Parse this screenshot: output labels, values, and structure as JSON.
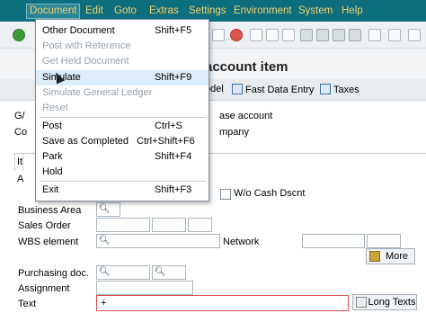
{
  "menubar": {
    "items": [
      "Document",
      "Edit",
      "Goto",
      "Extras",
      "Settings",
      "Environment",
      "System",
      "Help"
    ]
  },
  "title": "account item",
  "app_toolbar": {
    "model": "odel",
    "fast_data_entry": "Fast Data Entry",
    "taxes": "Taxes"
  },
  "header": {
    "label_g": "G/",
    "label_co": "Co",
    "label_i": "It",
    "label_a": "A",
    "gl_text": "ase account",
    "company_text": "mpany",
    "wo_cash": "W/o Cash Dscnt"
  },
  "form": {
    "business_area": "Business Area",
    "sales_order": "Sales Order",
    "wbs_element": "WBS element",
    "network": "Network",
    "more": "More",
    "purchasing_doc": "Purchasing doc.",
    "assignment": "Assignment",
    "text": "Text",
    "text_value": "+",
    "long_texts": "Long Texts"
  },
  "dropdown": {
    "items": [
      {
        "label": "Other Document",
        "shortcut": "Shift+F5",
        "disabled": false
      },
      {
        "label": "Post with Reference",
        "shortcut": "",
        "disabled": true
      },
      {
        "label": "Get Held Document",
        "shortcut": "",
        "disabled": true
      },
      {
        "label": "Simulate",
        "shortcut": "Shift+F9",
        "disabled": false
      },
      {
        "label": "Simulate General Ledger",
        "shortcut": "",
        "disabled": true
      },
      {
        "label": "Reset",
        "shortcut": "",
        "disabled": true
      },
      {
        "label": "Post",
        "shortcut": "Ctrl+S",
        "disabled": false
      },
      {
        "label": "Save as Completed",
        "shortcut": "Ctrl+Shift+F6",
        "disabled": false
      },
      {
        "label": "Park",
        "shortcut": "Shift+F4",
        "disabled": false
      },
      {
        "label": "Hold",
        "shortcut": "",
        "disabled": false
      },
      {
        "label": "Exit",
        "shortcut": "Shift+F3",
        "disabled": false
      }
    ]
  },
  "colors": {
    "menubar_bg": "#0d6e7e",
    "menubar_text": "#f5d06a",
    "highlight": "#dcecf8",
    "focus_border": "#d94b4b"
  }
}
